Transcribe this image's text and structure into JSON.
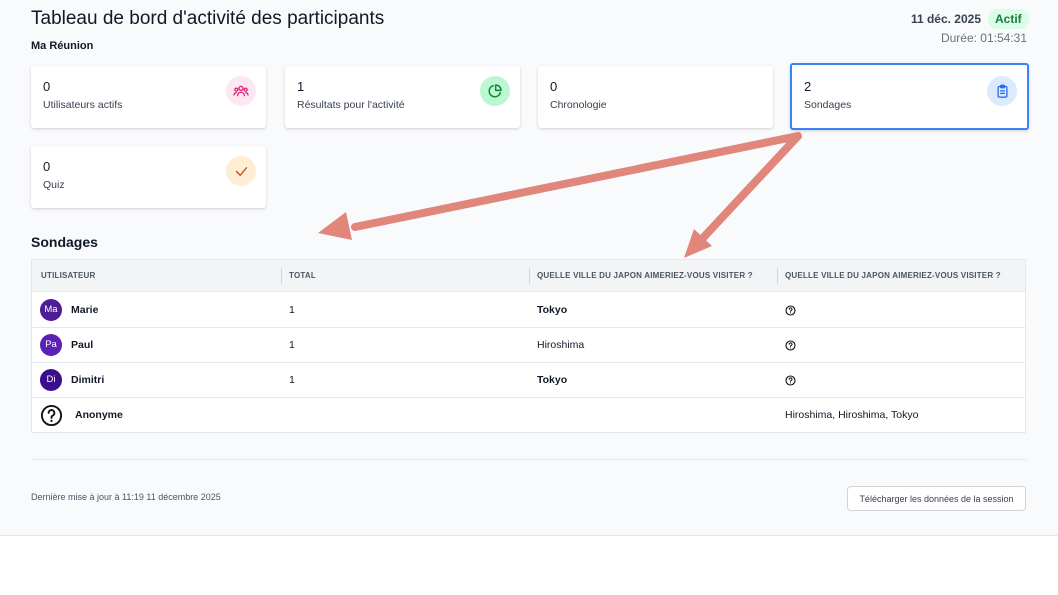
{
  "header": {
    "title": "Tableau de bord d'activité des participants",
    "meeting_name": "Ma Réunion",
    "date": "11 déc. 2025",
    "status": "Actif",
    "duration": "Durée: 01:54:31"
  },
  "cards": [
    {
      "value": "0",
      "label": "Utilisateurs actifs",
      "icon": "users-icon",
      "color": "#db2777",
      "bg": "#fce7f3"
    },
    {
      "value": "1",
      "label": "Résultats pour l'activité",
      "icon": "pie-chart-icon",
      "color": "#15803d",
      "bg": "#bbf7d0"
    },
    {
      "value": "0",
      "label": "Chronologie",
      "icon": "",
      "color": "",
      "bg": ""
    },
    {
      "value": "2",
      "label": "Sondages",
      "icon": "clipboard-icon",
      "color": "#2563eb",
      "bg": "#dbeafe"
    },
    {
      "value": "0",
      "label": "Quiz",
      "icon": "check-icon",
      "color": "#c2410c",
      "bg": "#ffedd5"
    }
  ],
  "polls": {
    "title": "Sondages",
    "columns": [
      "UTILISATEUR",
      "TOTAL",
      "QUELLE VILLE DU JAPON AIMERIEZ-VOUS VISITER ?",
      "QUELLE VILLE DU JAPON AIMERIEZ-VOUS VISITER ?"
    ],
    "rows": [
      {
        "initials": "Ma",
        "name": "Marie",
        "total": "1",
        "answer1": "Tokyo",
        "answer2": ""
      },
      {
        "initials": "Pa",
        "name": "Paul",
        "total": "1",
        "answer1": "Hiroshima",
        "answer2": ""
      },
      {
        "initials": "Di",
        "name": "Dimitri",
        "total": "1",
        "answer1": "Tokyo",
        "answer2": ""
      },
      {
        "initials": "",
        "name": "Anonyme",
        "total": "",
        "answer1": "",
        "answer2": "Hiroshima, Hiroshima, Tokyo"
      }
    ]
  },
  "footer": {
    "last_updated": "Dernière mise à jour à 11:19 11 décembre 2025",
    "download_label": "Télécharger les données de la session"
  },
  "colors": {
    "accent": "#3b82f6",
    "avatar": "#4c1d95",
    "annotation_arrow": "#e0867a"
  }
}
